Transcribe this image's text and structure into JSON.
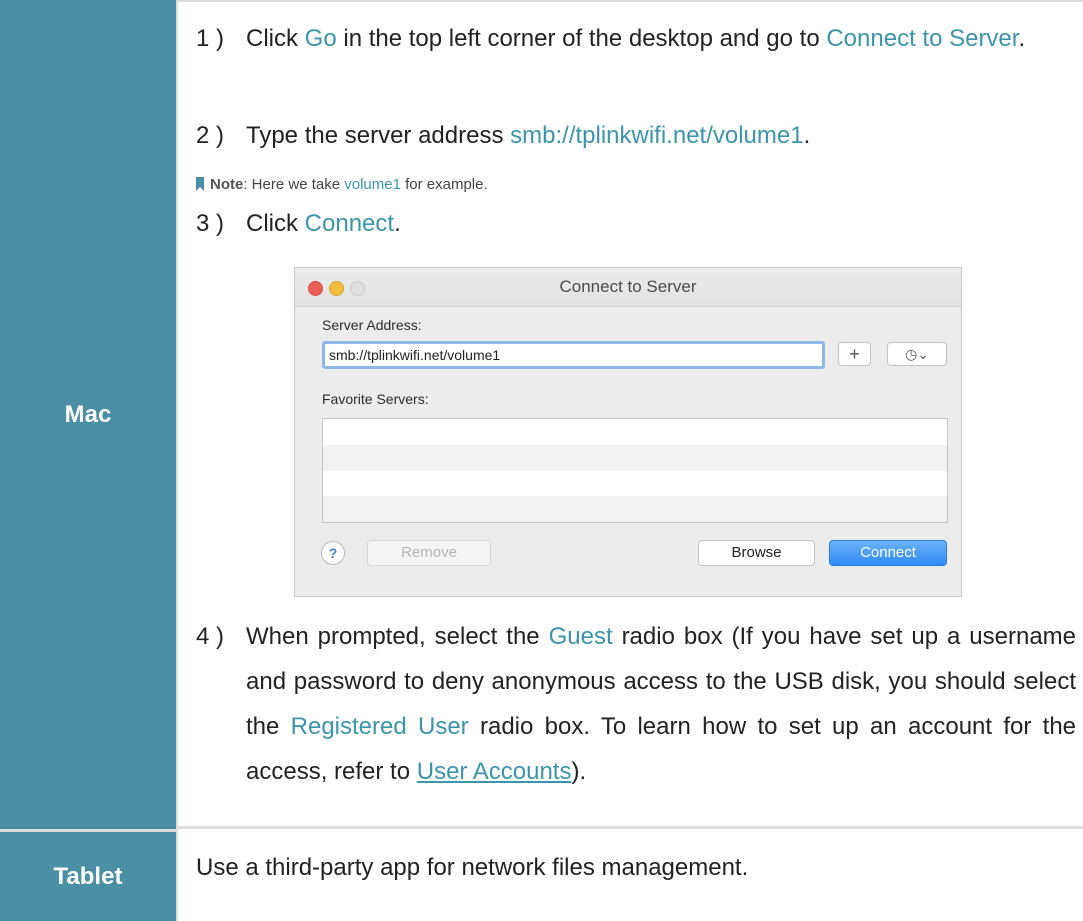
{
  "rows": {
    "mac_label": "Mac",
    "tablet_label": "Tablet"
  },
  "steps": [
    {
      "num": "1 )",
      "p1": "Click ",
      "go": "Go",
      "p2": " in the top left corner of the desktop and go to ",
      "cts": "Connect to Server",
      "p3": "."
    },
    {
      "num": "2 )",
      "p1": "Type the server address ",
      "addr": "smb://tplinkwifi.net/volume1",
      "p2": "."
    },
    {
      "num": "3 )",
      "p1": "Click ",
      "connect": "Connect",
      "p2": "."
    },
    {
      "num": "4 )",
      "p1": "When prompted, select the ",
      "guest": "Guest",
      "p2": " radio box (If you have set up a username and password to deny anonymous access to the USB disk, you should select the ",
      "reg": "Registered User",
      "p3": " radio box. To learn how to set up an account for the access, refer to ",
      "link": "User Accounts",
      "p4": ")."
    }
  ],
  "note": {
    "label": "Note",
    "p1": ": Here we take ",
    "hl": "volume1",
    "p2": " for example."
  },
  "dialog": {
    "title": "Connect to Server",
    "server_address_label": "Server Address:",
    "server_address_value": "smb://tplinkwifi.net/volume1",
    "favorite_servers_label": "Favorite Servers:",
    "add_glyph": "+",
    "history_glyph": "◷⌄",
    "help_glyph": "?",
    "remove_label": "Remove",
    "browse_label": "Browse",
    "connect_label": "Connect"
  },
  "tablet_text": "Use a third-party app for network files management.",
  "colors": {
    "label_bg": "#4a8fa3",
    "highlight": "#3b95ab",
    "connect_btn": "#2f8bf5"
  },
  "icons": [
    "bookmark-icon",
    "plus-icon",
    "history-icon",
    "help-icon"
  ]
}
